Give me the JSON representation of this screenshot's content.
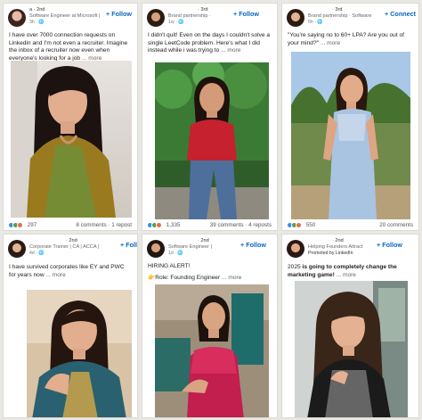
{
  "posts": [
    {
      "author_line": "a · 2nd",
      "headline": "Software Engineer at Microsoft |",
      "time": "3h · 🌐",
      "follow_label": "+ Follow",
      "text": "I have over 7000 connection requests on Linkedin and I'm not even a recruiter. Imagine the inbox of a recruiter now even when everyone's looking for a job",
      "more": "... more",
      "reaction_count": "297",
      "stats": "8 comments · 1 repost"
    },
    {
      "author_line": "· 3rd",
      "headline": "Brand partnership ·",
      "time": "1w · 🌐",
      "follow_label": "+ Follow",
      "text": "I didn't quit! Even on the days I couldn't solve a single LeetCode problem. Here's what I did instead while i was trying to",
      "more": "... more",
      "reaction_count": "1,335",
      "stats": "39 comments · 4 reposts"
    },
    {
      "author_line": "· 3rd",
      "headline": "Brand partnership · Software",
      "time": "5h · 🌐",
      "follow_label": "+ Connect",
      "text": "\"You're saying no to 60+ LPA? Are you out of your mind?\"",
      "more": "... more",
      "reaction_count": "550",
      "stats": "20 comments"
    },
    {
      "author_line": "· 2nd",
      "headline": "Corporate Trainer | CA | ACCA |",
      "time": "4d · 🌐",
      "follow_label": "+ Follow",
      "text": "I have survived corporates like EY and PWC for years now",
      "more": "... more"
    },
    {
      "author_line": "· 2nd",
      "headline": "Software Engineer |",
      "time": "1d · 🌐",
      "follow_label": "+ Follow",
      "text": "HIRING ALERT!",
      "text2": "👉Role: Founding Engineer",
      "more": "... more"
    },
    {
      "author_line": "· 2nd",
      "headline": "Helping Founders Attract",
      "promoted": "Promoted by LinkedIn",
      "follow_label": "+ Follow",
      "text_plain": "2025 ",
      "text_bold": "is going to completely change the marketing game!",
      "more": "... more"
    }
  ],
  "colors": {
    "accent": "#0a66c2",
    "background": "#e9e8e4",
    "card": "#ffffff"
  },
  "icons": [
    "globe-icon",
    "like-reaction-icon",
    "celebrate-reaction-icon",
    "love-reaction-icon"
  ]
}
